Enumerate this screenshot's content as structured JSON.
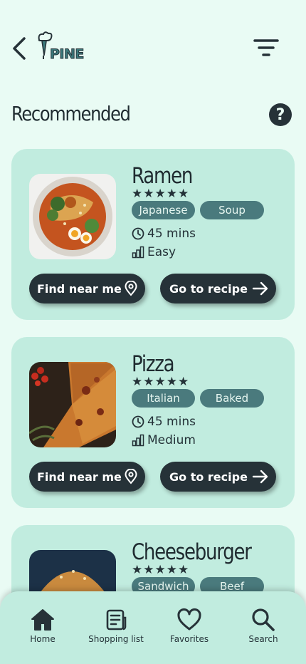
{
  "header": {
    "logo_text": "PINE",
    "section_title": "Recommended",
    "help_symbol": "?",
    "icons": {
      "back": "chevron-left-icon",
      "filter": "filter-icon",
      "help": "question-icon"
    }
  },
  "cards": [
    {
      "title": "Ramen",
      "rating": "★★★★★",
      "tags": [
        "Japanese",
        "Soup"
      ],
      "time": "45 mins",
      "difficulty": "Easy",
      "find_label": "Find near me",
      "recipe_label": "Go to recipe"
    },
    {
      "title": "Pizza",
      "rating": "★★★★★",
      "tags": [
        "Italian",
        "Baked"
      ],
      "time": "45 mins",
      "difficulty": "Medium",
      "find_label": "Find near me",
      "recipe_label": "Go to recipe"
    },
    {
      "title": "Cheeseburger",
      "rating": "★★★★★",
      "tags": [
        "Sandwich",
        "Beef"
      ]
    }
  ],
  "nav": [
    {
      "label": "Home",
      "icon": "home-icon"
    },
    {
      "label": "Shopping list",
      "icon": "list-icon"
    },
    {
      "label": "Favorites",
      "icon": "heart-icon"
    },
    {
      "label": "Search",
      "icon": "search-icon"
    }
  ],
  "colors": {
    "background": "#e9fbf4",
    "card": "#c1ecdf",
    "dark": "#263238",
    "tag": "#4a7a7d"
  }
}
